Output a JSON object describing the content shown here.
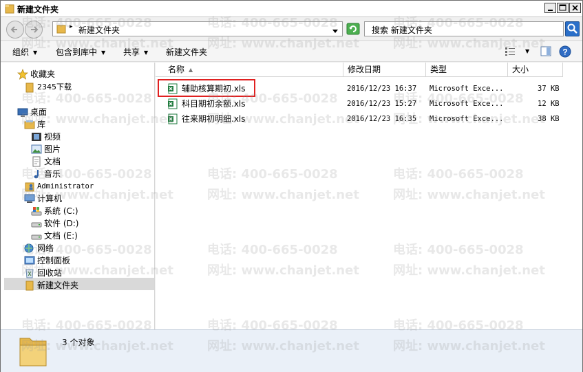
{
  "window": {
    "title": "新建文件夹"
  },
  "address": {
    "path": "新建文件夹"
  },
  "search": {
    "placeholder": "搜索 新建文件夹"
  },
  "toolbar": {
    "organize": "组织",
    "include_library": "包含到库中",
    "share": "共享",
    "new_folder": "新建文件夹"
  },
  "nav": {
    "favorites": "收藏夹",
    "downloads": "2345下载",
    "desktop": "桌面",
    "libraries": "库",
    "videos": "视频",
    "pictures": "图片",
    "documents": "文档",
    "music": "音乐",
    "user": "Administrator",
    "computer": "计算机",
    "drive_c": "系统 (C:)",
    "drive_d": "软件 (D:)",
    "drive_e": "文档 (E:)",
    "network": "网络",
    "control_panel": "控制面板",
    "recycle_bin": "回收站",
    "current_folder": "新建文件夹"
  },
  "columns": {
    "name": "名称",
    "date": "修改日期",
    "type": "类型",
    "size": "大小"
  },
  "files": [
    {
      "name": "辅助核算期初.xls",
      "date": "2016/12/23 16:37",
      "type": "Microsoft Exce...",
      "size": "37 KB"
    },
    {
      "name": "科目期初余额.xls",
      "date": "2016/12/23 15:27",
      "type": "Microsoft Exce...",
      "size": "12 KB"
    },
    {
      "name": "往来期初明细.xls",
      "date": "2016/12/23 16:35",
      "type": "Microsoft Exce...",
      "size": "38 KB"
    }
  ],
  "status": {
    "count": "3 个对象"
  },
  "watermark": {
    "phone": "电话: 400-665-0028",
    "site": "网址: www.chanjet.net"
  },
  "colors": {
    "highlight": "#e02020",
    "folder": "#e8b84a",
    "excel": "#1e7a3c"
  }
}
